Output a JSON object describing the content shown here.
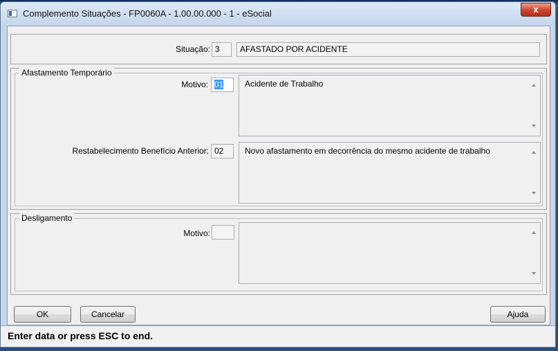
{
  "window": {
    "title": "Complemento Situações - FP0060A - 1.00.00.000 - 1 - eSocial",
    "close_glyph": "x"
  },
  "situacao": {
    "label": "Situação:",
    "code": "3",
    "description": "AFASTADO POR ACIDENTE"
  },
  "afastamento": {
    "group_title": "Afastamento Temporário",
    "motivo_label": "Motivo:",
    "motivo_code": "01",
    "motivo_description": "Acidente de Trabalho",
    "restab_label": "Restabelecimento Benefício Anterior:",
    "restab_code": "02",
    "restab_description": "Novo afastamento em decorrência do mesmo acidente de trabalho"
  },
  "desligamento": {
    "group_title": "Desligamento",
    "motivo_label": "Motivo:",
    "motivo_code": "",
    "motivo_description": ""
  },
  "buttons": {
    "ok": "OK",
    "cancel": "Cancelar",
    "help": "Ajuda"
  },
  "status": {
    "message": "Enter data or press ESC to end."
  }
}
